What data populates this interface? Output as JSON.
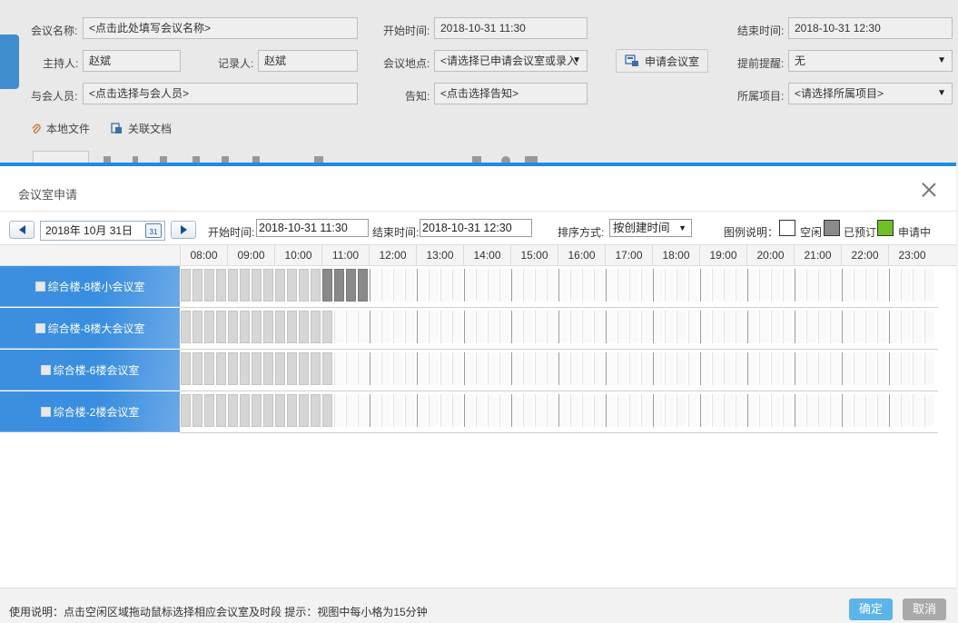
{
  "form": {
    "meeting_name": {
      "label": "会议名称:",
      "placeholder": "<点击此处填写会议名称>"
    },
    "start_time": {
      "label": "开始时间:",
      "value": "2018-10-31 11:30"
    },
    "end_time": {
      "label": "结束时间:",
      "value": "2018-10-31 12:30"
    },
    "host": {
      "label": "主持人:",
      "value": "赵斌"
    },
    "recorder": {
      "label": "记录人:",
      "value": "赵斌"
    },
    "location": {
      "label": "会议地点:",
      "value": "<请选择已申请会议室或录入"
    },
    "apply_room_button": "申请会议室",
    "reminder": {
      "label": "提前提醒:",
      "value": "无"
    },
    "participants": {
      "label": "与会人员:",
      "placeholder": "<点击选择与会人员>"
    },
    "notice": {
      "label": "告知:",
      "placeholder": "<点击选择告知>"
    },
    "project": {
      "label": "所属项目:",
      "value": "<请选择所属项目>"
    },
    "local_file": "本地文件",
    "related_doc": "关联文档"
  },
  "dialog": {
    "title": "会议室申请",
    "date_value": "2018年 10月 31日",
    "start_label": "开始时间:",
    "start_value": "2018-10-31 11:30",
    "end_label": "结束时间:",
    "end_value": "2018-10-31 12:30",
    "sort_label": "排序方式:",
    "sort_value": "按创建时间",
    "legend_label": "图例说明：",
    "legend": [
      {
        "label": "空闲",
        "color": "#ffffff"
      },
      {
        "label": "已预订",
        "color": "#8a8a8a"
      },
      {
        "label": "申请中",
        "color": "#6fbf2a"
      }
    ],
    "hours": [
      "08:00",
      "09:00",
      "10:00",
      "11:00",
      "12:00",
      "13:00",
      "14:00",
      "15:00",
      "16:00",
      "17:00",
      "18:00",
      "19:00",
      "20:00",
      "21:00",
      "22:00",
      "23:00"
    ],
    "slots_per_hour": 4,
    "rooms": [
      {
        "name": "综合楼-8楼小会议室",
        "booked": [
          [
            11.0,
            12.0
          ]
        ]
      },
      {
        "name": "综合楼-8楼大会议室",
        "booked": []
      },
      {
        "name": "综合楼-6楼会议室",
        "booked": []
      },
      {
        "name": "综合楼-2楼会议室",
        "booked": []
      }
    ],
    "past_until": 11.25,
    "footer_note": "使用说明：点击空闲区域拖动鼠标选择相应会议室及时段 提示：视图中每小格为15分钟",
    "ok_label": "确定",
    "cancel_label": "取消"
  }
}
